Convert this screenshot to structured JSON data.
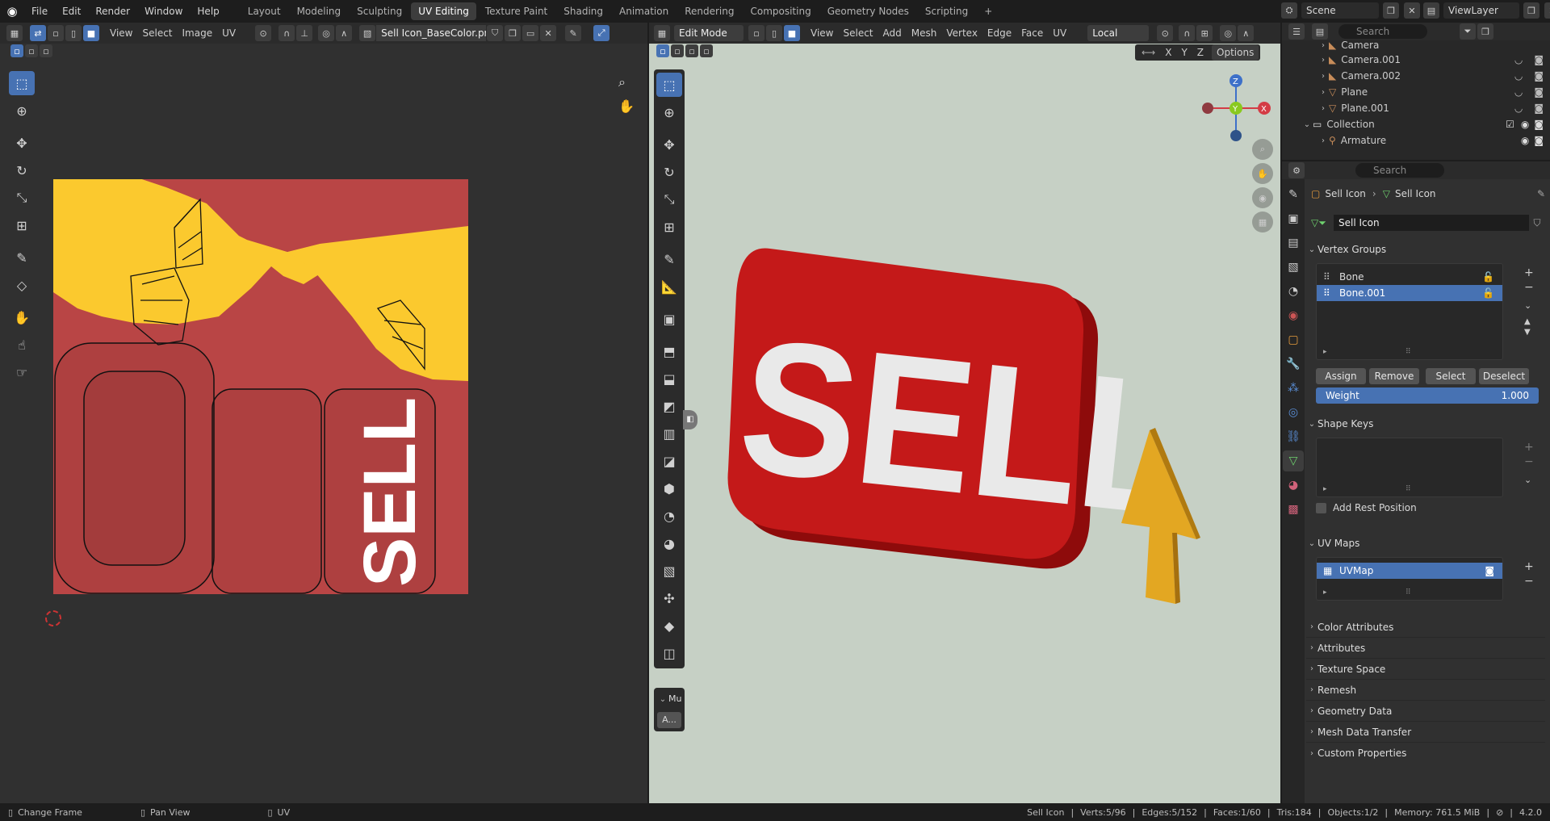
{
  "topbar": {
    "menus": [
      "File",
      "Edit",
      "Render",
      "Window",
      "Help"
    ],
    "workspaces": [
      "Layout",
      "Modeling",
      "Sculpting",
      "UV Editing",
      "Texture Paint",
      "Shading",
      "Animation",
      "Rendering",
      "Compositing",
      "Geometry Nodes",
      "Scripting"
    ],
    "active_workspace": "UV Editing",
    "add_tab": "+",
    "scene_label": "Scene",
    "viewlayer_label": "ViewLayer"
  },
  "uv_editor": {
    "menus": [
      "View",
      "Select",
      "Image",
      "UV"
    ],
    "image_name": "Sell Icon_BaseColor.png",
    "texture_text": "SELL"
  },
  "viewport": {
    "mode": "Edit Mode",
    "menus": [
      "View",
      "Select",
      "Add",
      "Mesh",
      "Vertex",
      "Edge",
      "Face",
      "UV"
    ],
    "transform_orientation": "Local",
    "options_label": "Options",
    "axis_lock": [
      "X",
      "Y",
      "Z"
    ],
    "gizmo": {
      "x": "X",
      "y": "Y",
      "z": "Z"
    },
    "sign_text": "SELL",
    "last_op_header": "Mu",
    "last_op_button": "A..."
  },
  "outliner": {
    "search_placeholder": "Search",
    "items": [
      {
        "name": "Camera",
        "type": "camera"
      },
      {
        "name": "Camera.001",
        "type": "camera"
      },
      {
        "name": "Camera.002",
        "type": "camera"
      },
      {
        "name": "Plane",
        "type": "mesh"
      },
      {
        "name": "Plane.001",
        "type": "mesh"
      }
    ],
    "collection": "Collection",
    "collection_child": "Armature"
  },
  "properties": {
    "search_placeholder": "Search",
    "breadcrumb_object": "Sell Icon",
    "breadcrumb_data": "Sell Icon",
    "mesh_name": "Sell Icon",
    "vertex_groups": {
      "title": "Vertex Groups",
      "items": [
        "Bone",
        "Bone.001"
      ],
      "selected": "Bone.001",
      "buttons": [
        "Assign",
        "Remove",
        "Select",
        "Deselect"
      ],
      "weight_label": "Weight",
      "weight_value": "1.000"
    },
    "shape_keys": {
      "title": "Shape Keys",
      "add_rest_position": "Add Rest Position"
    },
    "uv_maps": {
      "title": "UV Maps",
      "items": [
        "UVMap"
      ]
    },
    "collapsed_panels": [
      "Color Attributes",
      "Attributes",
      "Texture Space",
      "Remesh",
      "Geometry Data",
      "Mesh Data Transfer",
      "Custom Properties"
    ]
  },
  "status_bar": {
    "left": [
      "Change Frame",
      "Pan View",
      "UV"
    ],
    "object": "Sell Icon",
    "verts": "Verts:5/96",
    "edges": "Edges:5/152",
    "faces": "Faces:1/60",
    "tris": "Tris:184",
    "objects": "Objects:1/2",
    "memory": "Memory: 761.5 MiB",
    "version": "4.2.0"
  },
  "colors": {
    "accent": "#4772b3",
    "texture_red": "#b94545",
    "texture_yellow": "#fbc92e",
    "sign_red": "#c41919",
    "arrow_yellow": "#e3a722",
    "viewport_bg": "#c6d0c5"
  }
}
